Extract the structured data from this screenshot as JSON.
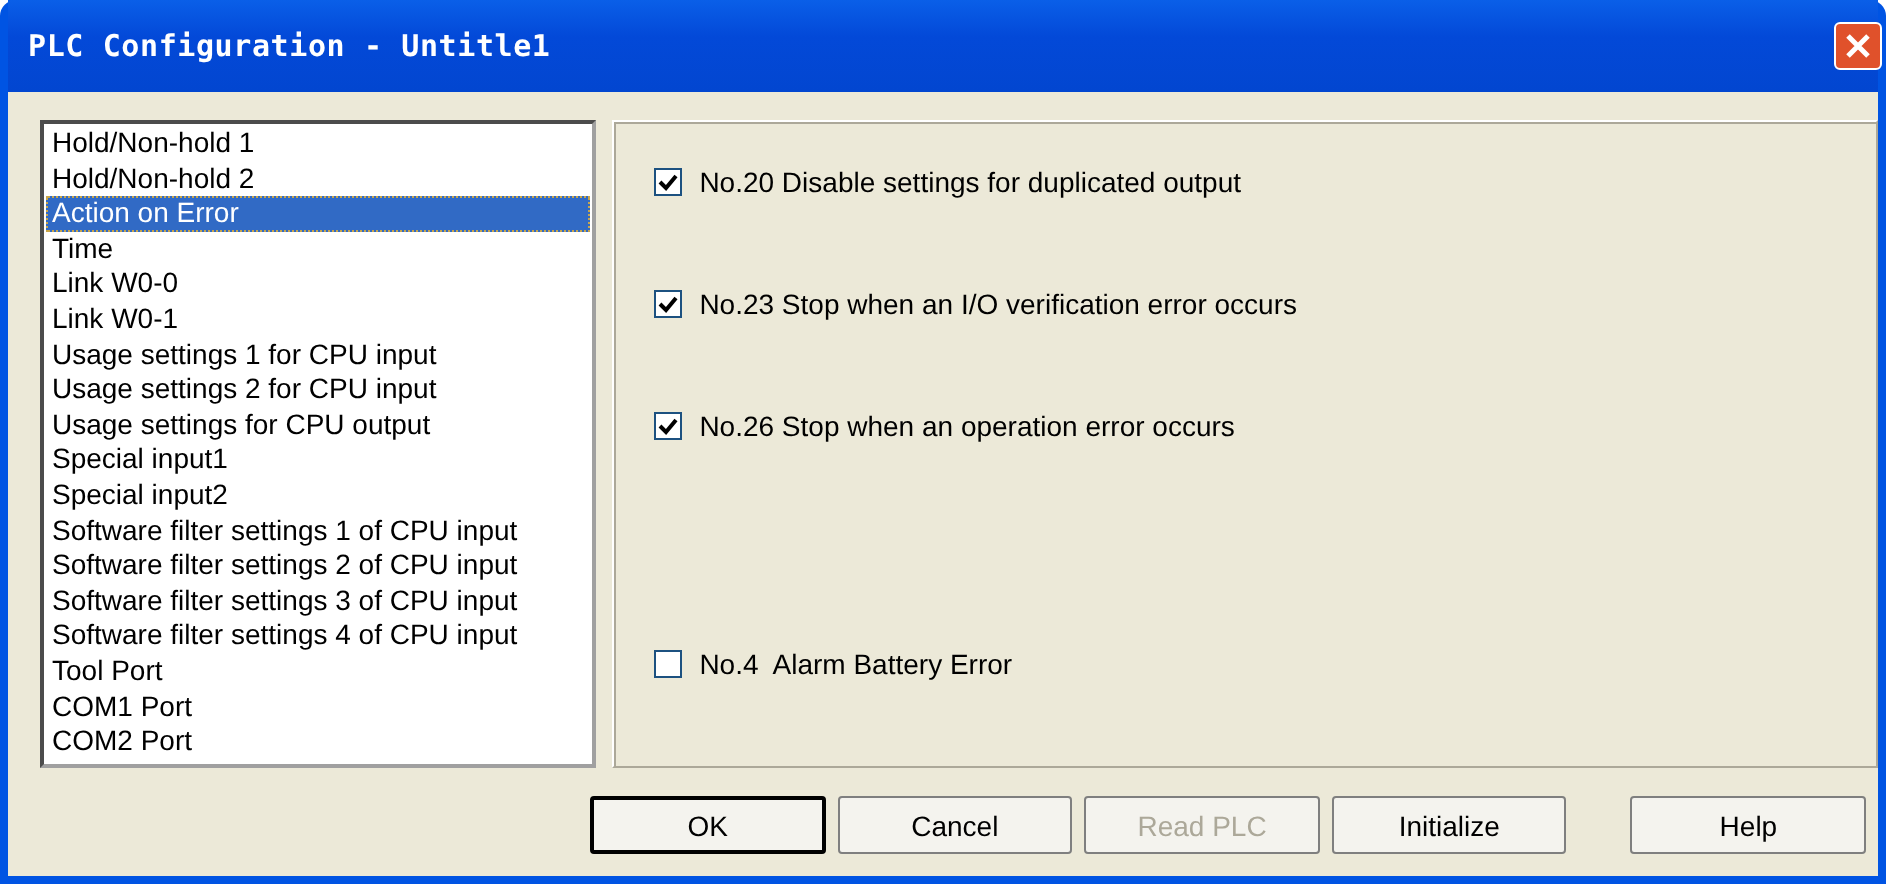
{
  "window": {
    "title": "PLC Configuration - Untitle1"
  },
  "sidebar": {
    "items": [
      {
        "label": "Hold/Non-hold 1",
        "selected": false
      },
      {
        "label": "Hold/Non-hold 2",
        "selected": false
      },
      {
        "label": "Action on Error",
        "selected": true
      },
      {
        "label": "Time",
        "selected": false
      },
      {
        "label": "Link W0-0",
        "selected": false
      },
      {
        "label": "Link W0-1",
        "selected": false
      },
      {
        "label": "Usage settings 1 for CPU input",
        "selected": false
      },
      {
        "label": "Usage settings 2 for CPU input",
        "selected": false
      },
      {
        "label": "Usage settings for CPU output",
        "selected": false
      },
      {
        "label": "Special input1",
        "selected": false
      },
      {
        "label": "Special input2",
        "selected": false
      },
      {
        "label": "Software filter settings 1 of CPU input",
        "selected": false
      },
      {
        "label": "Software filter settings 2 of CPU input",
        "selected": false
      },
      {
        "label": "Software filter settings 3 of CPU input",
        "selected": false
      },
      {
        "label": "Software filter settings 4 of CPU input",
        "selected": false
      },
      {
        "label": "Tool Port",
        "selected": false
      },
      {
        "label": "COM1 Port",
        "selected": false
      },
      {
        "label": "COM2 Port",
        "selected": false
      }
    ]
  },
  "options": [
    {
      "label": "No.20 Disable settings for duplicated output",
      "checked": true
    },
    {
      "label": "No.23 Stop when an I/O verification error occurs",
      "checked": true
    },
    {
      "label": "No.26 Stop when an operation error occurs",
      "checked": true
    },
    {
      "label": "No.4  Alarm Battery Error",
      "checked": false
    }
  ],
  "buttons": [
    {
      "label": "OK",
      "default": true,
      "disabled": false
    },
    {
      "label": "Cancel",
      "default": false,
      "disabled": false
    },
    {
      "label": "Read PLC",
      "default": false,
      "disabled": true
    },
    {
      "label": "Initialize",
      "default": false,
      "disabled": false
    },
    {
      "label": "Help",
      "default": false,
      "disabled": false
    }
  ]
}
